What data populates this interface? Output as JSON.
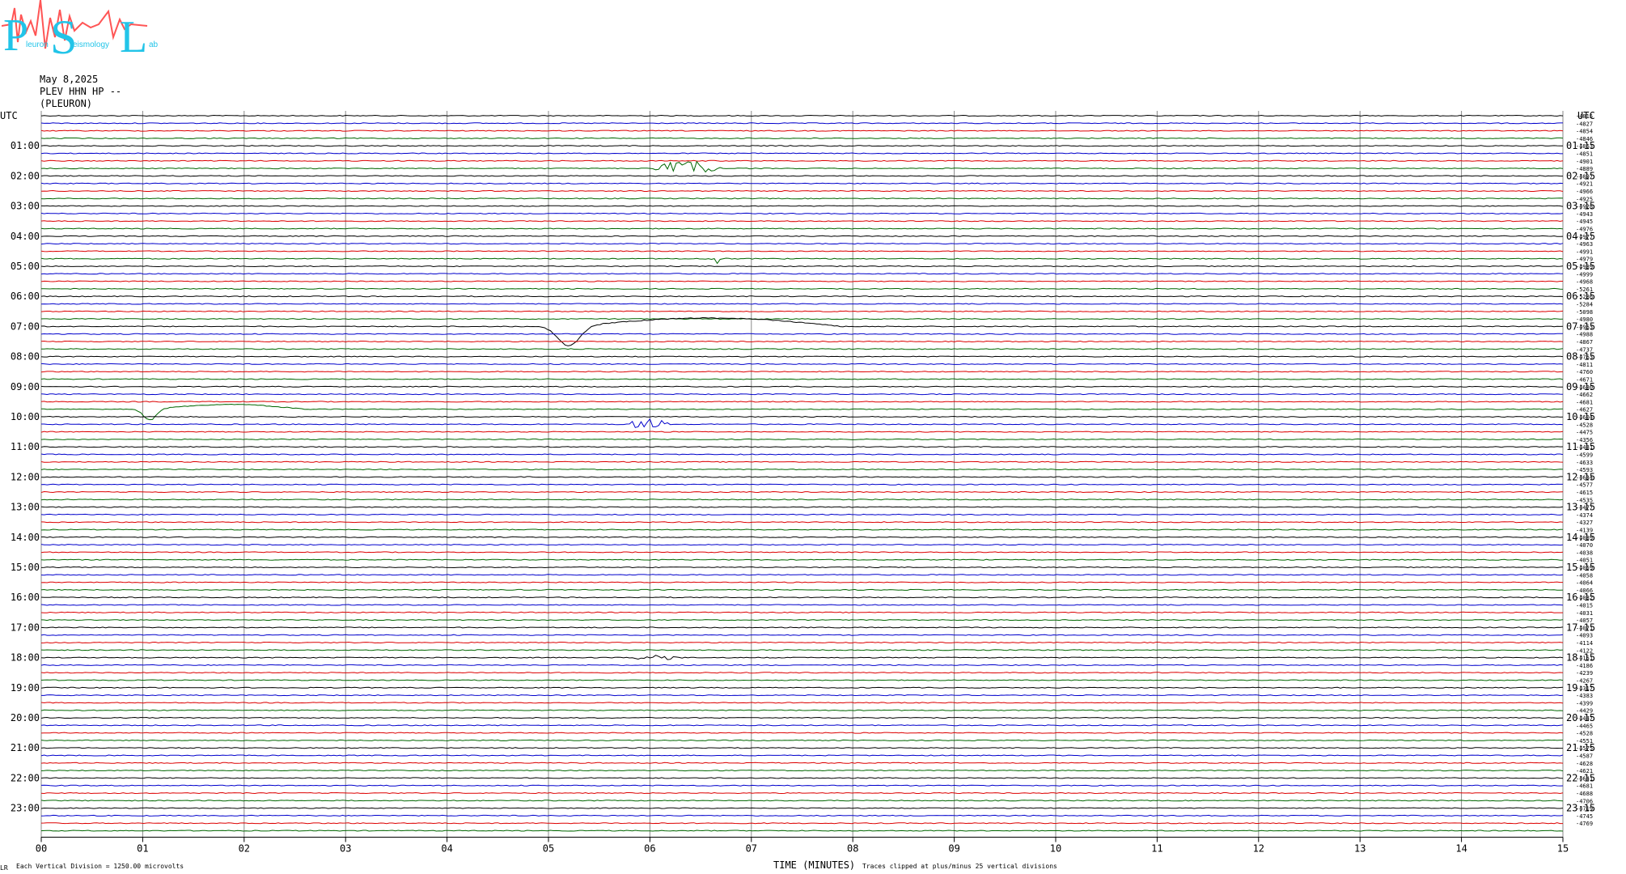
{
  "logo": {
    "letters": [
      "P",
      "S",
      "L"
    ],
    "subtext": [
      "leuron",
      "eismology",
      "ab"
    ]
  },
  "header": {
    "date": "May 8,2025",
    "station": "PLEV HHN HP --",
    "site": "(PLEURON)"
  },
  "left_axis_title": "UTC",
  "right_axis_title": "UTC",
  "footer": {
    "corner": "LR",
    "scale_note": "Each Vertical Division = 1250.00 microvolts",
    "xlabel": "TIME (MINUTES)",
    "clip_note": "Traces clipped at plus/minus 25 vertical divisions"
  },
  "colors": {
    "trace_cycle": [
      "#000000",
      "#0000cc",
      "#dd0000",
      "#006600"
    ],
    "grid": "#888888",
    "logo_cyan": "#22c4e8",
    "logo_red": "#ff5555"
  },
  "chart_data": {
    "type": "line",
    "subtype": "helicorder",
    "title": "",
    "xlabel": "TIME (MINUTES)",
    "xlim": [
      0,
      15
    ],
    "x_ticks": [
      "00",
      "01",
      "02",
      "03",
      "04",
      "05",
      "06",
      "07",
      "08",
      "09",
      "10",
      "11",
      "12",
      "13",
      "14",
      "15"
    ],
    "rows_per_hour": 4,
    "minutes_per_row": 15,
    "left_hour_labels": [
      "01:00",
      "02:00",
      "03:00",
      "04:00",
      "05:00",
      "06:00",
      "07:00",
      "08:00",
      "09:00",
      "10:00",
      "11:00",
      "12:00",
      "13:00",
      "14:00",
      "15:00",
      "16:00",
      "17:00",
      "18:00",
      "19:00",
      "20:00",
      "21:00",
      "22:00",
      "23:00"
    ],
    "right_hour_labels": [
      "01:15",
      "02:15",
      "03:15",
      "04:15",
      "05:15",
      "06:15",
      "07:15",
      "08:15",
      "09:15",
      "10:15",
      "11:15",
      "12:15",
      "13:15",
      "14:15",
      "15:15",
      "16:15",
      "17:15",
      "18:15",
      "19:15",
      "20:15",
      "21:15",
      "22:15",
      "23:15"
    ],
    "row_offsets": [
      "-4815",
      "-4827",
      "-4854",
      "-4846",
      "-4863",
      "-4851",
      "-4901",
      "-4889",
      "-4897",
      "-4921",
      "-4966",
      "-4925",
      "-4928",
      "-4943",
      "-4945",
      "-4976",
      "-4977",
      "-4963",
      "-4991",
      "-4979",
      "-4989",
      "-4999",
      "-4968",
      "-5261",
      "-5286",
      "-5284",
      "-5098",
      "-4980",
      "-4963",
      "-4988",
      "-4867",
      "-4737",
      "-4763",
      "-4811",
      "-4760",
      "-4671",
      "-4680",
      "-4662",
      "-4681",
      "-4627",
      "-4604",
      "-4528",
      "-4475",
      "-4356",
      "-4481",
      "-4599",
      "-4633",
      "-4593",
      "-4634",
      "-4577",
      "-4615",
      "-4535",
      "-4477",
      "-4374",
      "-4327",
      "-4139",
      "-4089",
      "-4070",
      "-4038",
      "-4051",
      "-4059",
      "-4058",
      "-4064",
      "-4066",
      "-4082",
      "-4015",
      "-4031",
      "-4057",
      "-4071",
      "-4093",
      "-4114",
      "-4122",
      "-4151",
      "-4186",
      "-4239",
      "-4267",
      "-4317",
      "-4383",
      "-4399",
      "-4429",
      "-4447",
      "-4465",
      "-4528",
      "-4551",
      "-4575",
      "-4587",
      "-4628",
      "-4621",
      "-4641",
      "-4681",
      "-4688",
      "-4706",
      "-4719",
      "-4745",
      "-4769"
    ],
    "traces_count": 96,
    "events": [
      {
        "row": 7,
        "minute_start": 6.05,
        "minute_end": 7.0,
        "kind": "burst",
        "amplitude": 1.2
      },
      {
        "row": 19,
        "minute_start": 6.6,
        "minute_end": 6.8,
        "kind": "spike",
        "amplitude": 0.7
      },
      {
        "row": 28,
        "minute_start": 4.9,
        "minute_end": 7.9,
        "kind": "long_period",
        "amplitude": 3.2
      },
      {
        "row": 39,
        "minute_start": 0.9,
        "minute_end": 2.6,
        "kind": "long_period",
        "amplitude": 1.8
      },
      {
        "row": 41,
        "minute_start": 5.8,
        "minute_end": 6.4,
        "kind": "burst",
        "amplitude": 1.2
      },
      {
        "row": 48,
        "minute_start": 10.75,
        "minute_end": 10.85,
        "kind": "spike",
        "amplitude": 0.5
      },
      {
        "row": 72,
        "minute_start": 5.85,
        "minute_end": 6.5,
        "kind": "burst",
        "amplitude": 0.6
      }
    ]
  }
}
